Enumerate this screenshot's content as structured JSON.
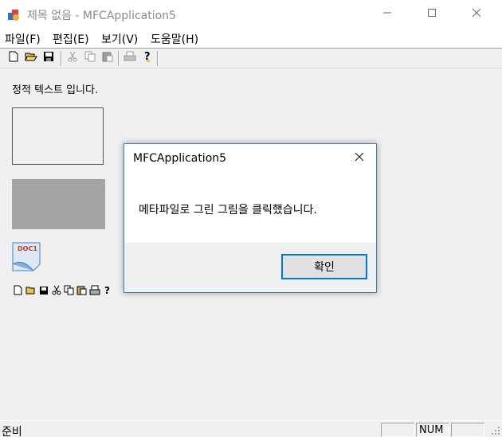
{
  "window": {
    "title": "제목 없음 - MFCApplication5",
    "icon": "app-icon",
    "caption_buttons": [
      "minimize-icon",
      "maximize-icon",
      "close-icon"
    ]
  },
  "menu": {
    "items": [
      {
        "label": "파일(F)"
      },
      {
        "label": "편집(E)"
      },
      {
        "label": "보기(V)"
      },
      {
        "label": "도움말(H)"
      }
    ]
  },
  "toolbar": {
    "buttons": [
      "new-icon",
      "open-icon",
      "save-icon",
      "cut-icon",
      "copy-icon",
      "paste-icon",
      "print-icon",
      "help-icon"
    ]
  },
  "client": {
    "static_text": "정적 텍스트 입니다.",
    "metafile_icon_text": "DOC1",
    "colors": {
      "background": "#f0f0f0",
      "gray_rect": "#a4a4a4"
    }
  },
  "statusbar": {
    "text": "준비",
    "num_indicator": "NUM"
  },
  "dialog": {
    "title": "MFCApplication5",
    "message": "메타파일로 그린 그림을 클릭했습니다.",
    "ok_label": "확인",
    "accent": "#0078d7"
  }
}
